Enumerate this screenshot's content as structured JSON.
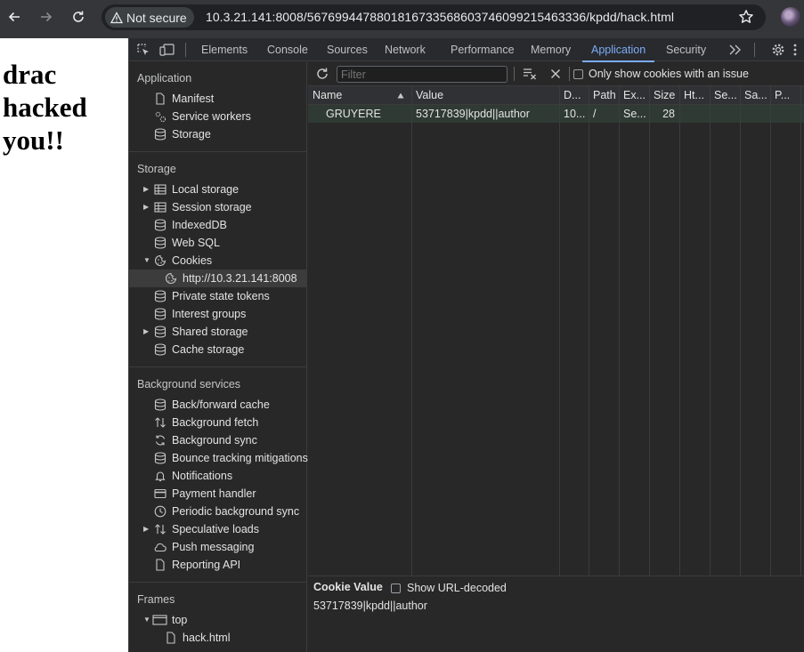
{
  "browser": {
    "security_label": "Not secure",
    "url": "10.3.21.141:8008/5676994478801816733568603746099215463336/kpdd/hack.html"
  },
  "page": {
    "lines": [
      "drac",
      "hacked",
      "you!!"
    ]
  },
  "devtools": {
    "tabs": [
      "Elements",
      "Console",
      "Sources",
      "Network",
      "Performance",
      "Memory",
      "Application",
      "Security"
    ],
    "active_tab": "Application",
    "sidebar": {
      "application_title": "Application",
      "application_items": [
        "Manifest",
        "Service workers",
        "Storage"
      ],
      "storage_title": "Storage",
      "storage_items": [
        "Local storage",
        "Session storage",
        "IndexedDB",
        "Web SQL",
        "Cookies",
        "http://10.3.21.141:8008",
        "Private state tokens",
        "Interest groups",
        "Shared storage",
        "Cache storage"
      ],
      "background_title": "Background services",
      "background_items": [
        "Back/forward cache",
        "Background fetch",
        "Background sync",
        "Bounce tracking mitigations",
        "Notifications",
        "Payment handler",
        "Periodic background sync",
        "Speculative loads",
        "Push messaging",
        "Reporting API"
      ],
      "frames_title": "Frames",
      "frames_items": [
        "top",
        "hack.html"
      ]
    },
    "cookies": {
      "filter_placeholder": "Filter",
      "only_issue_label": "Only show cookies with an issue",
      "columns": [
        "Name",
        "Value",
        "D...",
        "Path",
        "Ex...",
        "Size",
        "Ht...",
        "Se...",
        "Sa...",
        "P..."
      ],
      "rows": [
        {
          "name": "GRUYERE",
          "value": "53717839|kpdd||author",
          "domain": "10...",
          "path": "/",
          "expires": "Se...",
          "size": "28"
        }
      ],
      "cookie_value_title": "Cookie Value",
      "show_decoded_label": "Show URL-decoded",
      "cookie_value": "53717839|kpdd||author"
    }
  }
}
